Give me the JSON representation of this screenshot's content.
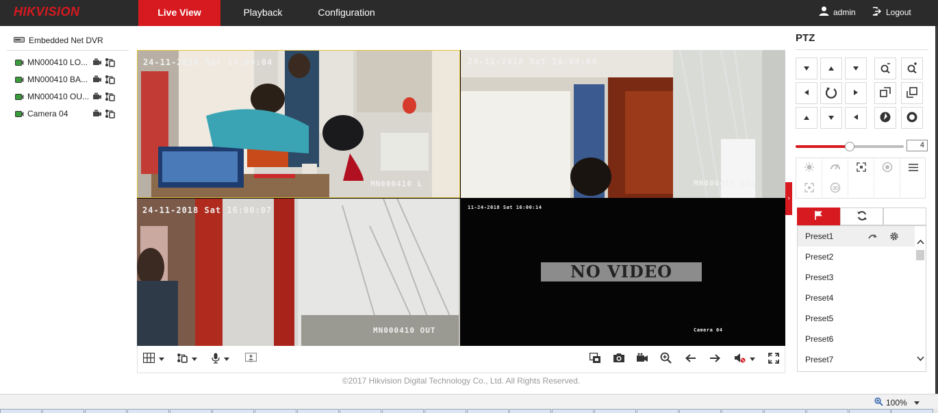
{
  "header": {
    "logo": "HIKVISION",
    "tabs": [
      {
        "label": "Live View",
        "active": true
      },
      {
        "label": "Playback",
        "active": false
      },
      {
        "label": "Configuration",
        "active": false
      }
    ],
    "user": "admin",
    "logout": "Logout"
  },
  "tree": {
    "root": "Embedded Net DVR",
    "cameras": [
      {
        "label": "MN000410 LO..."
      },
      {
        "label": "MN000410 BA..."
      },
      {
        "label": "MN000410 OU..."
      },
      {
        "label": "Camera 04"
      }
    ]
  },
  "video": {
    "tiles": [
      {
        "timestamp": "24-11-2018 Sat 16:00:04",
        "osd_name": "MN000410  L",
        "selected": true
      },
      {
        "timestamp": "24-11-2018 Sat 16:00:04",
        "osd_name": "MN000410 BAC",
        "selected": false
      },
      {
        "timestamp": "24-11-2018 Sat 16:00:07",
        "osd_name": "MN000410 OUT",
        "selected": false
      },
      {
        "timestamp": "11-24-2018 Sat 16:00:14",
        "osd_name": "Camera 04",
        "no_video": "NO VIDEO",
        "selected": false
      }
    ]
  },
  "footer": "©2017 Hikvision Digital Technology Co., Ltd. All Rights Reserved.",
  "ptz": {
    "title": "PTZ",
    "speed": "4",
    "speed_fraction": 0.5,
    "presets": [
      "Preset1",
      "Preset2",
      "Preset3",
      "Preset4",
      "Preset5",
      "Preset6",
      "Preset7"
    ]
  },
  "status": {
    "zoom": "100%"
  },
  "colors": {
    "accent": "#d71920",
    "topbar": "#2b2b2b",
    "selected_border": "#e3c13b"
  }
}
